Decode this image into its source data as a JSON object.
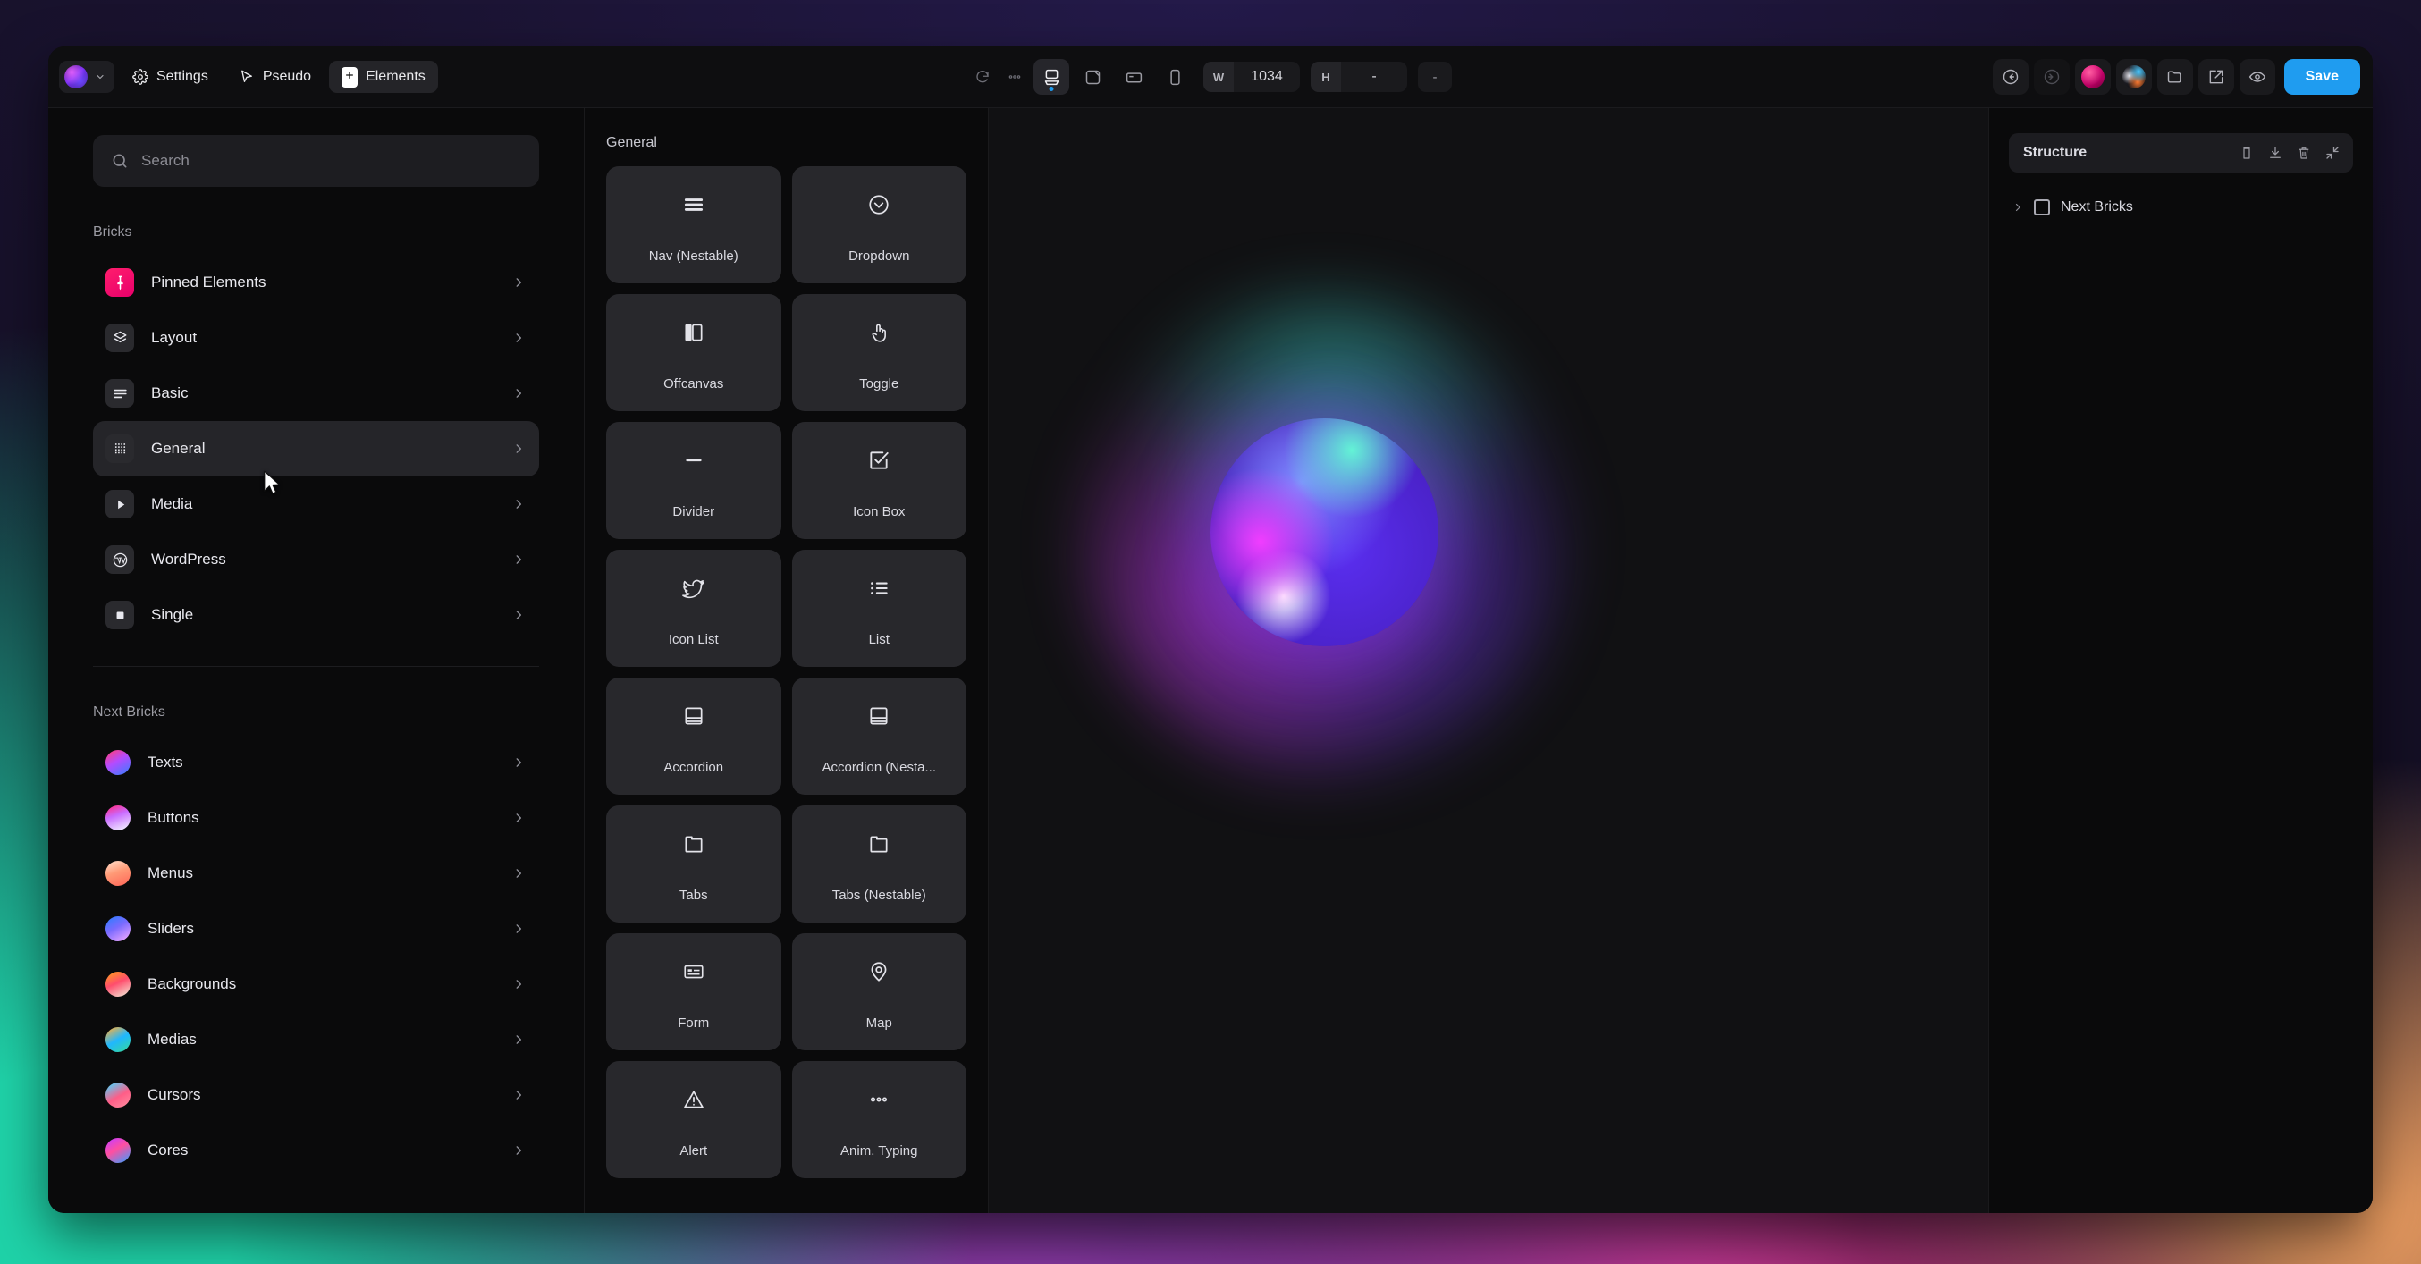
{
  "topbar": {
    "logo_icon": "brand-orb-icon",
    "logo_chevron_icon": "chevron-down-icon",
    "settings_label": "Settings",
    "settings_icon": "gear-icon",
    "pseudo_label": "Pseudo",
    "pseudo_icon": "cursor-arrow-icon",
    "elements_label": "Elements",
    "elements_icon": "plus-grid-icon",
    "refresh_icon": "refresh-icon",
    "more_icon": "more-dots-icon",
    "devices": [
      {
        "name": "device-desktop",
        "icon": "desktop-icon",
        "selected": true
      },
      {
        "name": "device-laptop",
        "icon": "laptop-icon",
        "selected": false
      },
      {
        "name": "device-tablet",
        "icon": "tablet-icon",
        "selected": false
      },
      {
        "name": "device-mobile",
        "icon": "mobile-icon",
        "selected": false
      }
    ],
    "width_label": "W",
    "width_value": "1034",
    "height_label": "H",
    "height_value": "-",
    "scale_value": "-",
    "right_actions": [
      {
        "name": "undo-button",
        "icon": "undo-icon"
      },
      {
        "name": "redo-button",
        "icon": "redo-icon"
      },
      {
        "name": "account-orb-button",
        "icon": "pink-orb-icon"
      },
      {
        "name": "theme-orb-button",
        "icon": "multicolor-orb-icon"
      },
      {
        "name": "folder-button",
        "icon": "folder-icon"
      },
      {
        "name": "open-external-button",
        "icon": "external-link-icon"
      },
      {
        "name": "preview-button",
        "icon": "eye-icon"
      }
    ],
    "save_label": "Save"
  },
  "sidebar": {
    "search_placeholder": "Search",
    "search_value": "",
    "search_icon": "search-icon",
    "groups": [
      {
        "title": "Bricks",
        "items": [
          {
            "label": "Pinned Elements",
            "icon": "pin-icon",
            "style": "pink",
            "active": false
          },
          {
            "label": "Layout",
            "icon": "layers-icon",
            "style": "grey",
            "active": false
          },
          {
            "label": "Basic",
            "icon": "lines-icon",
            "style": "grey",
            "active": false
          },
          {
            "label": "General",
            "icon": "grid-dots-icon",
            "style": "grey",
            "active": true
          },
          {
            "label": "Media",
            "icon": "play-icon",
            "style": "grey",
            "active": false
          },
          {
            "label": "WordPress",
            "icon": "wordpress-icon",
            "style": "grey",
            "active": false
          },
          {
            "label": "Single",
            "icon": "square-icon",
            "style": "grey",
            "active": false
          }
        ]
      },
      {
        "title": "Next Bricks",
        "items": [
          {
            "label": "Texts",
            "icon": "orb-icon",
            "style": "texts",
            "active": false
          },
          {
            "label": "Buttons",
            "icon": "orb-icon",
            "style": "buttons",
            "active": false
          },
          {
            "label": "Menus",
            "icon": "orb-icon",
            "style": "menus",
            "active": false
          },
          {
            "label": "Sliders",
            "icon": "orb-icon",
            "style": "sliders",
            "active": false
          },
          {
            "label": "Backgrounds",
            "icon": "orb-icon",
            "style": "backgrounds",
            "active": false
          },
          {
            "label": "Medias",
            "icon": "orb-icon",
            "style": "medias",
            "active": false
          },
          {
            "label": "Cursors",
            "icon": "orb-icon",
            "style": "cursors",
            "active": false
          },
          {
            "label": "Cores",
            "icon": "orb-icon",
            "style": "cores",
            "active": false
          }
        ]
      }
    ]
  },
  "elements_panel": {
    "title": "General",
    "cards": [
      {
        "label": "Nav (Nestable)",
        "icon": "hamburger-icon"
      },
      {
        "label": "Dropdown",
        "icon": "chevron-down-circle-icon"
      },
      {
        "label": "Offcanvas",
        "icon": "offcanvas-panel-icon"
      },
      {
        "label": "Toggle",
        "icon": "pointing-hand-icon"
      },
      {
        "label": "Divider",
        "icon": "horizontal-line-icon"
      },
      {
        "label": "Icon Box",
        "icon": "checked-box-icon"
      },
      {
        "label": "Icon List",
        "icon": "bird-icon"
      },
      {
        "label": "List",
        "icon": "bullet-list-icon"
      },
      {
        "label": "Accordion",
        "icon": "accordion-icon"
      },
      {
        "label": "Accordion (Nesta...",
        "icon": "accordion-icon"
      },
      {
        "label": "Tabs",
        "icon": "folder-tab-icon"
      },
      {
        "label": "Tabs (Nestable)",
        "icon": "folder-tab-icon"
      },
      {
        "label": "Form",
        "icon": "form-field-icon"
      },
      {
        "label": "Map",
        "icon": "map-pin-icon"
      },
      {
        "label": "Alert",
        "icon": "warning-triangle-icon"
      },
      {
        "label": "Anim. Typing",
        "icon": "three-dots-icon"
      }
    ]
  },
  "canvas": {
    "element_name": "gradient-sphere-graphic"
  },
  "right_panel": {
    "structure_title": "Structure",
    "actions": [
      {
        "name": "copy-structure-button",
        "icon": "copy-icon"
      },
      {
        "name": "import-structure-button",
        "icon": "download-icon"
      },
      {
        "name": "delete-structure-button",
        "icon": "trash-icon"
      },
      {
        "name": "collapse-all-button",
        "icon": "collapse-arrows-icon"
      }
    ],
    "tree": [
      {
        "label": "Next Bricks",
        "expand_icon": "chevron-right-icon",
        "node_icon": "square-outline-icon"
      }
    ]
  },
  "colors": {
    "accent": "#1f9cf0",
    "brand_pink": "#ff1d6c",
    "panel_bg": "#0a0a0b",
    "card_bg": "#28282c",
    "canvas_bg": "#111113"
  }
}
